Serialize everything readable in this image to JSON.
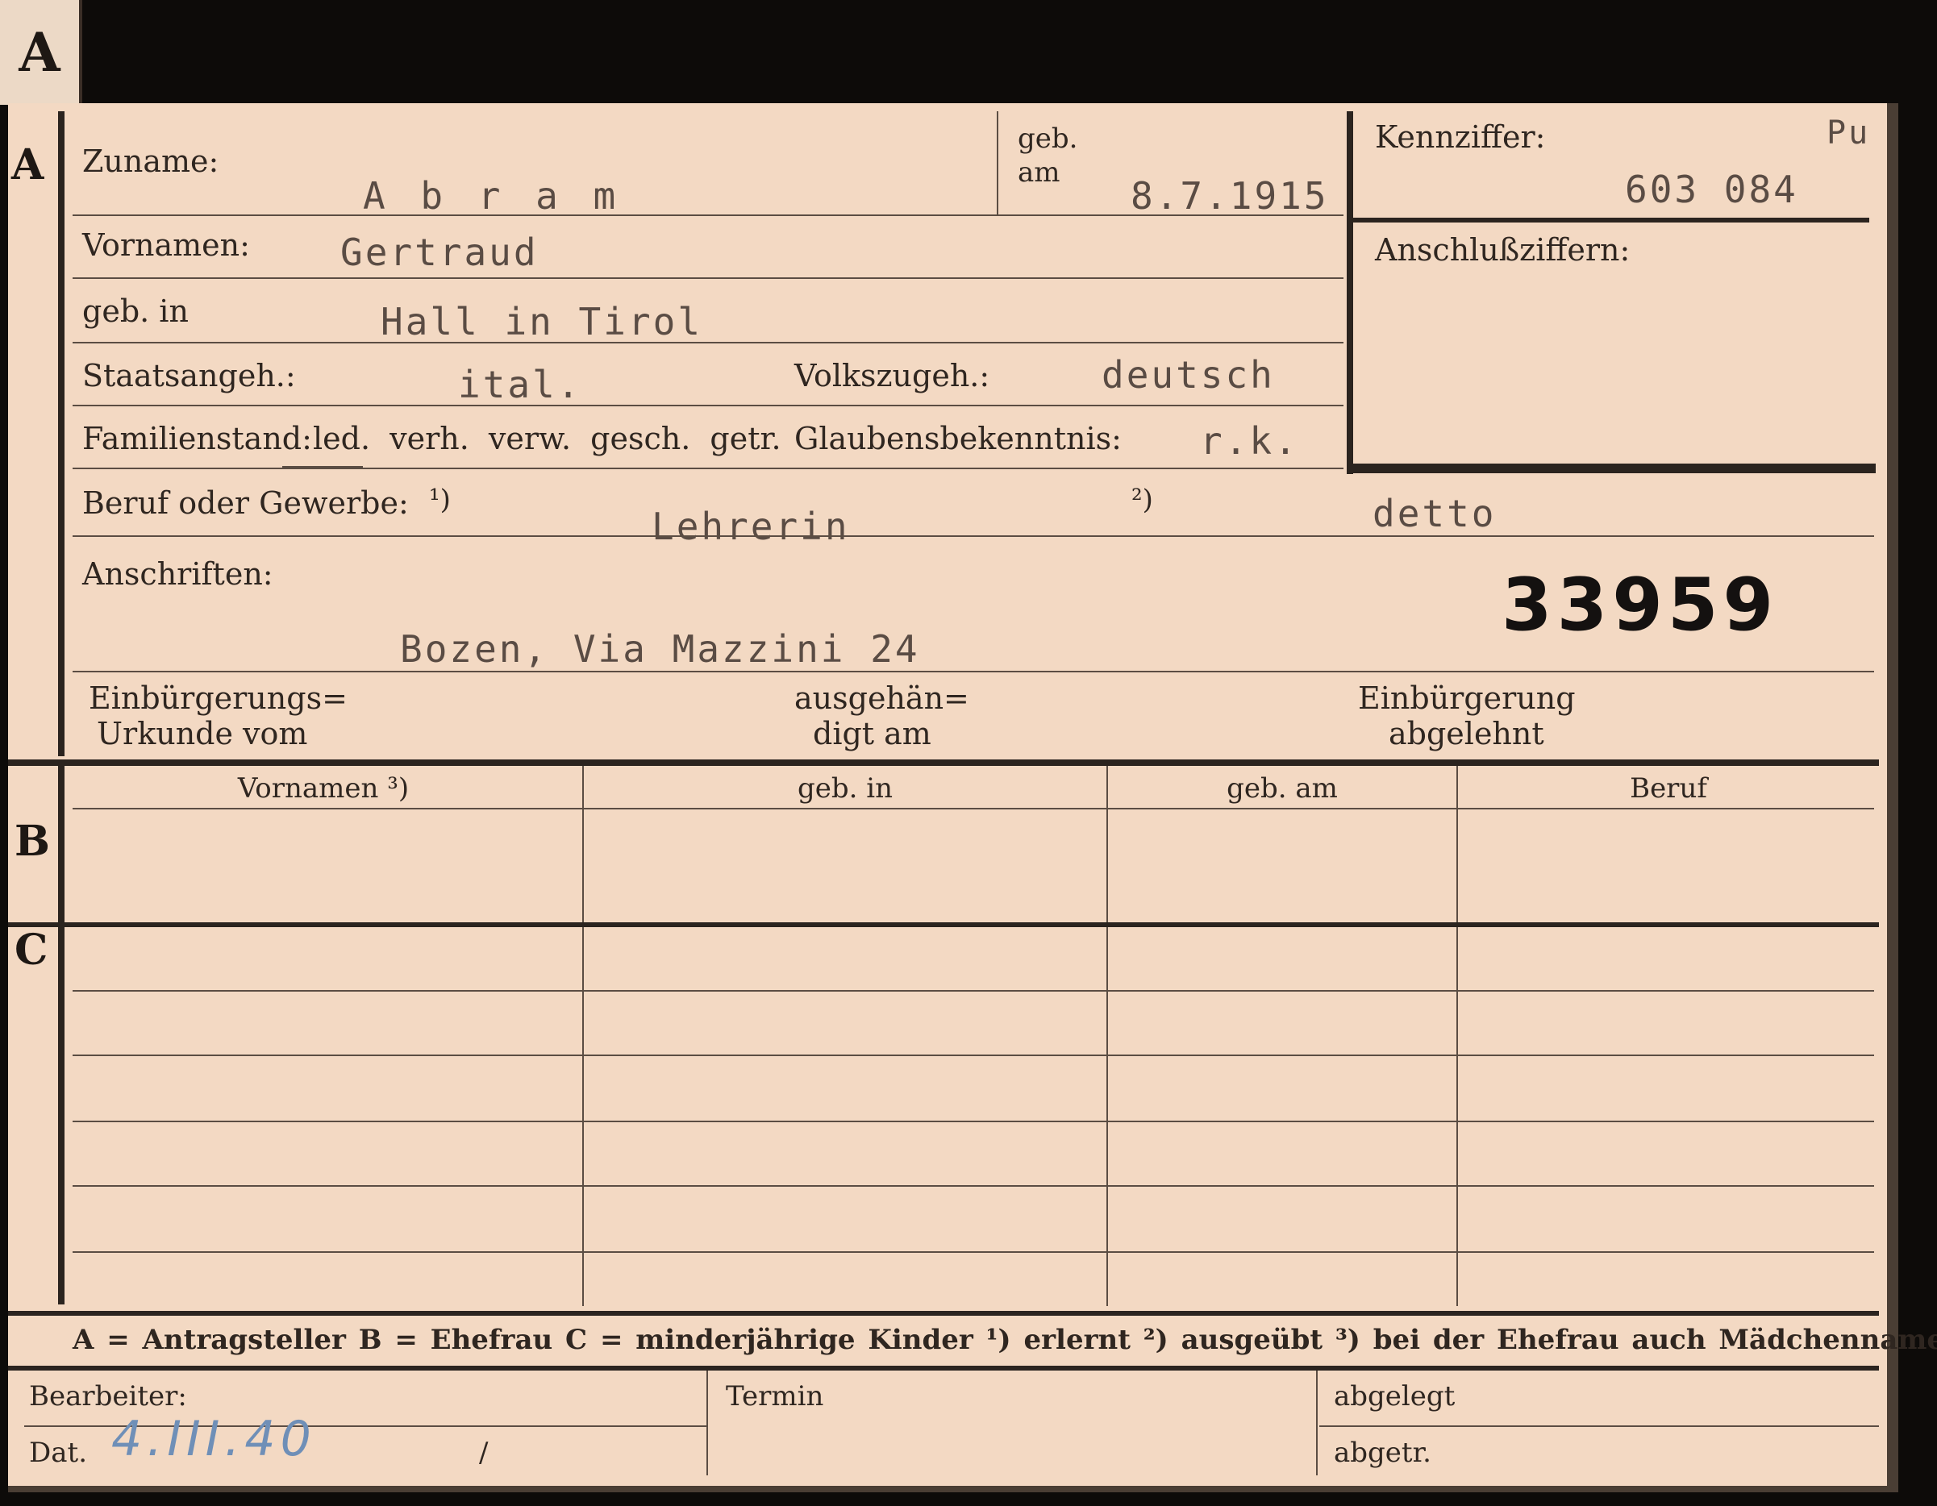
{
  "tab_letter": "A",
  "sections": {
    "a": "A",
    "b": "B",
    "c": "C"
  },
  "labels": {
    "zuname": "Zuname:",
    "geb": "geb.",
    "am": "am",
    "kennziffer": "Kennziffer:",
    "vornamen": "Vornamen:",
    "anschlussziffern": "Anschlußziffern:",
    "geb_in": "geb. in",
    "staatsangeh": "Staatsangeh.:",
    "volkszugeh": "Volkszugeh.:",
    "familienstand": "Familienstand:",
    "familienstand_options": "led.  verh.  verw.  gesch.  getr.",
    "glaubensbekenntnis": "Glaubensbekenntnis:",
    "beruf": "Beruf oder Gewerbe:",
    "beruf_note1": "¹)",
    "beruf_note2": "²)",
    "anschriften": "Anschriften:",
    "einbuergerungs_1": "Einbürgerungs=",
    "einbuergerungs_2": "Urkunde vom",
    "ausgehaen_1": "ausgehän=",
    "ausgehaen_2": "digt am",
    "einbuergerung_1": "Einbürgerung",
    "einbuergerung_2": "abgelehnt"
  },
  "values": {
    "zuname": "A b r a m",
    "geb_am": "8.7.1915",
    "kennziffer": "603 084",
    "corner_mark": "Pu",
    "vornamen": "Gertraud",
    "geb_in": "Hall in Tirol",
    "staatsangeh": "ital.",
    "volkszugeh": "deutsch",
    "glaubensbekenntnis": "r.k.",
    "beruf_erlernt": "Lehrerin",
    "beruf_ausgeuebt": "detto",
    "anschrift": "Bozen, Via Mazzini 24",
    "big_number": "33959"
  },
  "table_b": {
    "headers": [
      "Vornamen ³)",
      "geb. in",
      "geb. am",
      "Beruf"
    ]
  },
  "legend": "A = Antragsteller    B = Ehefrau    C = minderjährige Kinder    ¹) erlernt    ²) ausgeübt    ³) bei der Ehefrau auch Mädchenname",
  "footer": {
    "bearbeiter": "Bearbeiter:",
    "termin": "Termin",
    "abgelegt": "abgelegt",
    "dat": "Dat.",
    "dat_value": "4.III.40",
    "slash": "/",
    "abgetr": "abgetr."
  }
}
